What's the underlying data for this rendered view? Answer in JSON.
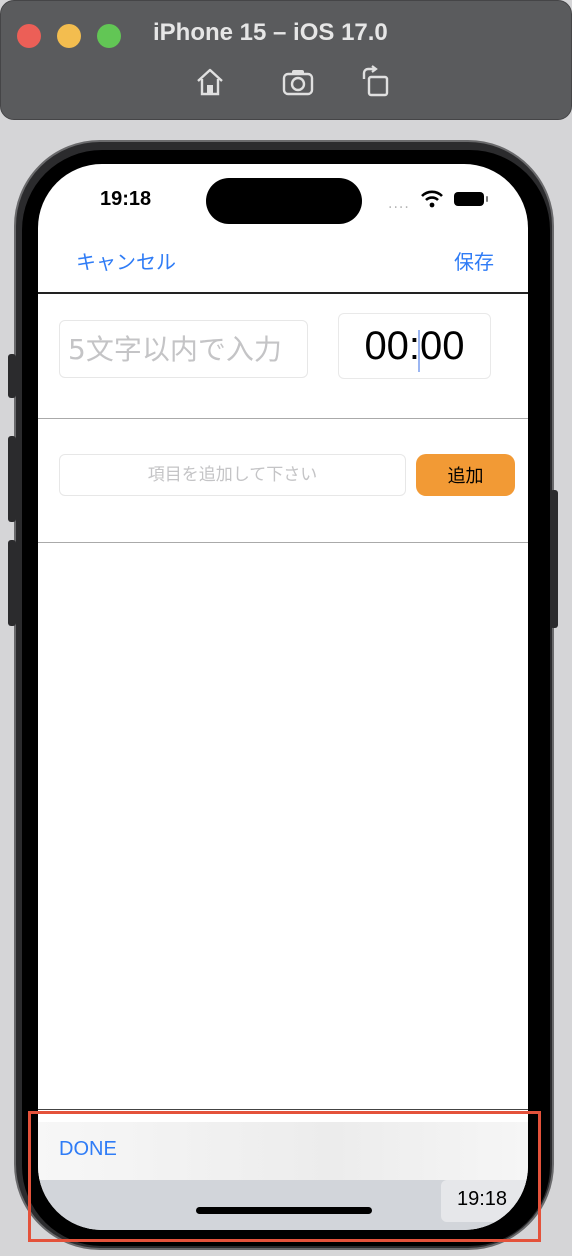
{
  "simulator": {
    "title": "iPhone 15 – iOS 17.0",
    "tools": [
      "home-icon",
      "screenshot-icon",
      "rotate-icon"
    ]
  },
  "status_bar": {
    "time": "19:18",
    "dots": "...."
  },
  "nav": {
    "cancel_label": "キャンセル",
    "save_label": "保存"
  },
  "form": {
    "name_placeholder": "5文字以内で入力",
    "time_value": "00:00",
    "item_placeholder": "項目を追加して下さい",
    "add_label": "追加"
  },
  "keyboard": {
    "done_label": "DONE",
    "time_key": "19:18"
  },
  "colors": {
    "accent": "#2f7cf6",
    "add_button": "#f29a35",
    "highlight": "#e4523b"
  }
}
